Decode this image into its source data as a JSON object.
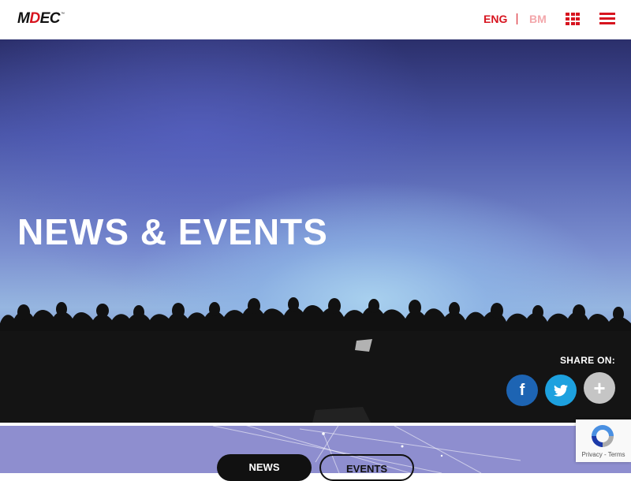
{
  "header": {
    "logo_text": "MDEC",
    "logo_tm": "™",
    "lang_eng": "ENG",
    "lang_bm": "BM"
  },
  "hero": {
    "title": "NEWS & EVENTS"
  },
  "share": {
    "label": "SHARE ON:",
    "facebook_glyph": "f",
    "more_glyph": "+"
  },
  "tabs": {
    "news": "NEWS",
    "events": "EVENTS"
  },
  "recaptcha": {
    "privacy": "Privacy",
    "separator": " - ",
    "terms": "Terms"
  },
  "colors": {
    "brand_red": "#d7141f",
    "facebook": "#1d64b3",
    "twitter": "#1da1df",
    "sub_bg": "#8e8ecf"
  },
  "icons": [
    "grid-icon",
    "menu-icon",
    "facebook-icon",
    "twitter-icon",
    "plus-icon",
    "recaptcha-icon"
  ]
}
